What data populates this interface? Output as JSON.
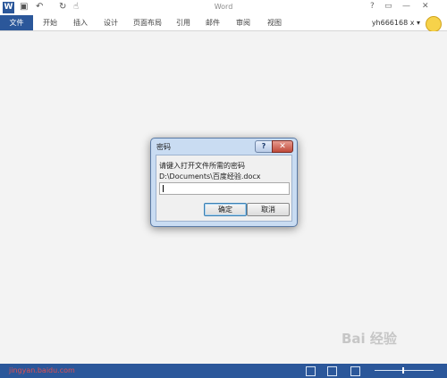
{
  "app": {
    "title": "Word",
    "logo": "W"
  },
  "quick_access": [
    {
      "name": "save-icon",
      "glyph": "▣"
    },
    {
      "name": "undo-icon",
      "glyph": "↶"
    },
    {
      "name": "redo-icon",
      "glyph": "↻"
    },
    {
      "name": "touch-mode-icon",
      "glyph": "☝"
    }
  ],
  "window_controls": {
    "help": "?",
    "restore": "▭",
    "minimize": "—",
    "close": "✕"
  },
  "ribbon": {
    "file": "文件",
    "tabs": [
      "开始",
      "插入",
      "设计",
      "页面布局",
      "引用",
      "邮件",
      "审阅",
      "视图"
    ]
  },
  "user": {
    "name": "yh666168 x ▾"
  },
  "dialog": {
    "title": "密码",
    "help": "?",
    "close": "✕",
    "prompt": "请键入打开文件所需的密码",
    "path": "D:\\Documents\\百度经验.docx",
    "password_value": "",
    "ok": "确定",
    "cancel": "取消"
  },
  "watermark": "Bai 经验",
  "statusbar": {
    "left_text": "jingyan.baidu.com"
  },
  "colors": {
    "accent": "#2b579a",
    "dialog_frame": "#c9dcf2",
    "close": "#c04a3a"
  }
}
